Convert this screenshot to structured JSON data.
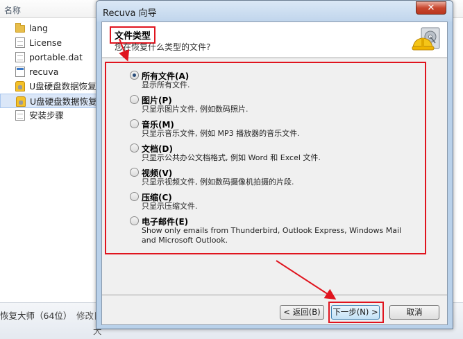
{
  "explorer": {
    "column_header": "名称",
    "files": [
      {
        "name": "lang",
        "icon": "folder-icon"
      },
      {
        "name": "License",
        "icon": "document-icon"
      },
      {
        "name": "portable.dat",
        "icon": "document-icon"
      },
      {
        "name": "recuva",
        "icon": "executable-icon"
      },
      {
        "name": "U盘硬盘数据恢复大",
        "icon": "app-icon"
      },
      {
        "name": "U盘硬盘数据恢复大",
        "icon": "app-icon"
      },
      {
        "name": "安装步骤",
        "icon": "document-icon"
      }
    ],
    "status_left": "恢复大师（64位）",
    "status_modified": "修改日",
    "status_size": "大"
  },
  "dialog": {
    "title": "Recuva 向导",
    "close_label": "✕",
    "header_title": "文件类型",
    "header_subtitle": "您在恢复什么类型的文件?",
    "options": [
      {
        "label": "所有文件(A)",
        "desc": "显示所有文件.",
        "checked": true
      },
      {
        "label": "图片(P)",
        "desc": "只显示图片文件, 例如数码照片.",
        "checked": false
      },
      {
        "label": "音乐(M)",
        "desc": "只显示音乐文件, 例如 MP3 播放器的音乐文件.",
        "checked": false
      },
      {
        "label": "文档(D)",
        "desc": "只显示公共办公文档格式, 例如 Word 和 Excel 文件.",
        "checked": false
      },
      {
        "label": "视频(V)",
        "desc": "只显示视频文件, 例如数码摄像机拍摄的片段.",
        "checked": false
      },
      {
        "label": "压缩(C)",
        "desc": "只显示压缩文件.",
        "checked": false
      },
      {
        "label": "电子邮件(E)",
        "desc": "Show only emails from Thunderbird, Outlook Express, Windows Mail and Microsoft Outlook.",
        "checked": false
      }
    ],
    "buttons": {
      "back": "< 返回(B)",
      "next": "下一步(N) >",
      "cancel": "取消"
    }
  },
  "colors": {
    "annotation_red": "#e0141e",
    "dialog_frame": "#b9d1ea",
    "client_bg": "#f0f0f0"
  }
}
